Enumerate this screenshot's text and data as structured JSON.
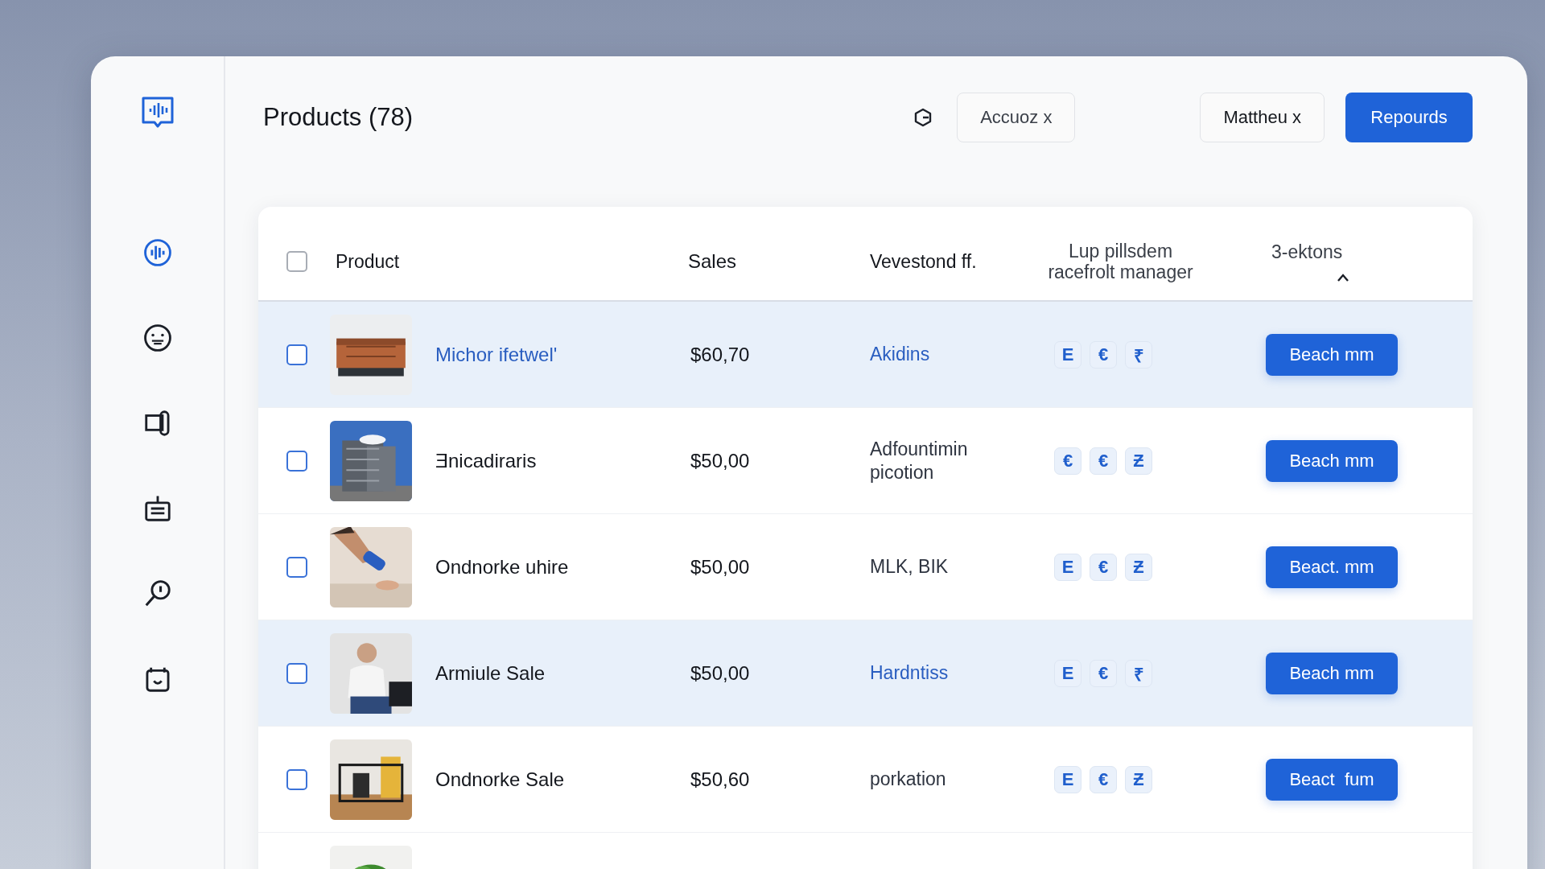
{
  "sidebar": {
    "items": [
      {
        "selected": true
      },
      {
        "selected": false
      },
      {
        "selected": false
      },
      {
        "selected": false
      },
      {
        "selected": false
      },
      {
        "selected": false
      }
    ]
  },
  "header": {
    "title": "Products (78)",
    "chips": [
      "Accuoz x",
      "Matthеu x"
    ],
    "primary_button": "Repourds"
  },
  "table": {
    "all_checked": false,
    "columns": [
      "Product",
      "Sales",
      "Vevestond ff.",
      "Lup pillsdem racefrolt manager",
      "3-ektons"
    ],
    "rows": [
      {
        "highlighted": true,
        "checked": false,
        "name": "Michor ifetwel'",
        "name_is_link": true,
        "sales": "$60,70",
        "column_3": "Akidins",
        "chips": [
          "E",
          "€",
          "₹"
        ],
        "action": "Beach mm"
      },
      {
        "highlighted": false,
        "checked": false,
        "name": "Ǝnicadiraris",
        "name_is_link": false,
        "sales": "$50,00",
        "column_3": "Adfountimin picotion",
        "chips": [
          "€",
          "€",
          "Ƶ"
        ],
        "action": "Beach mm"
      },
      {
        "highlighted": false,
        "checked": false,
        "name": "Ondnorke uhire",
        "name_is_link": false,
        "sales": "$50,00",
        "column_3": "MLK, BIK",
        "chips": [
          "E",
          "€",
          "Ƶ"
        ],
        "action": "Beact. mm"
      },
      {
        "highlighted": true,
        "checked": false,
        "name": "Armiule Sale",
        "name_is_link": false,
        "sales": "$50,00",
        "column_3": "Hardntiss",
        "chips": [
          "E",
          "€",
          "₹"
        ],
        "action": "Beach mm"
      },
      {
        "highlighted": false,
        "checked": false,
        "name": "Ondnorke Sale",
        "name_is_link": false,
        "sales": "$50,60",
        "column_3": "porkation",
        "chips": [
          "E",
          "€",
          "Ƶ"
        ],
        "action": "Beact  fum"
      },
      {
        "highlighted": false
      }
    ]
  }
}
